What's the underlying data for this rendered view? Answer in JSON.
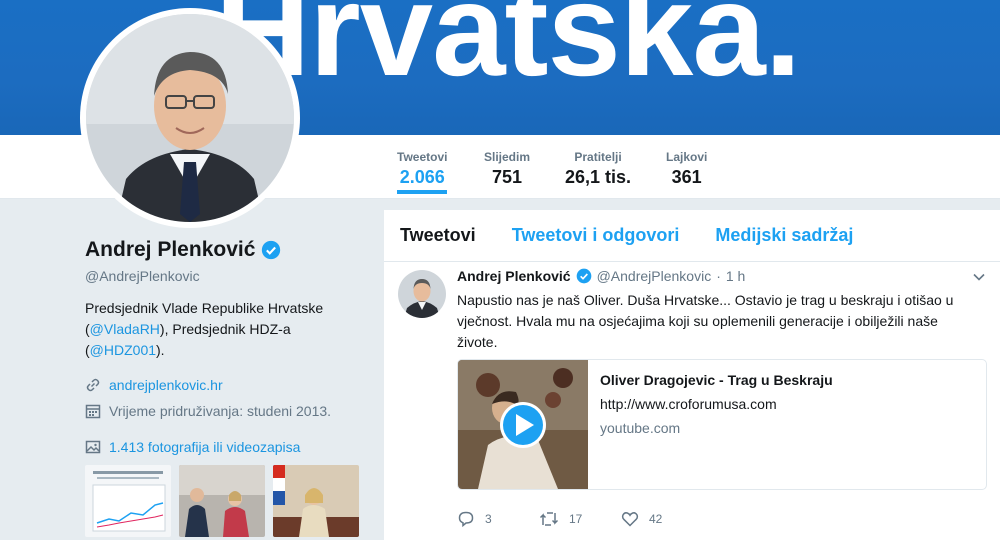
{
  "banner": {
    "text": "Hrvatska."
  },
  "stats": [
    {
      "label": "Tweetovi",
      "value": "2.066"
    },
    {
      "label": "Slijedim",
      "value": "751"
    },
    {
      "label": "Pratitelji",
      "value": "26,1 tis."
    },
    {
      "label": "Lajkovi",
      "value": "361"
    }
  ],
  "profile": {
    "name": "Andrej Plenković",
    "handle": "@AndrejPlenkovic",
    "bio": {
      "line1": "Predsjednik Vlade Republike Hrvatske",
      "open1": "(",
      "mention1": "@VladaRH",
      "mid": "), Predsjednik HDZ-a",
      "open2": "(",
      "mention2": "@HDZ001",
      "close2": ")."
    },
    "website": "andrejplenkovic.hr",
    "joined": "Vrijeme pridruživanja: studeni 2013.",
    "media": "1.413 fotografija ili videozapisa"
  },
  "tabs": [
    "Tweetovi",
    "Tweetovi i odgovori",
    "Medijski sadržaj"
  ],
  "tweet": {
    "name": "Andrej Plenković",
    "handle": "@AndrejPlenkovic",
    "sep": "·",
    "time": "1 h",
    "text": "Napustio nas je naš Oliver. Duša Hrvatske... Ostavio je trag u beskraju i otišao u vječnost. Hvala mu na osjećajima koji su oplemenili generacije i obilježili naše živote.",
    "card": {
      "title": "Oliver Dragojevic - Trag u Beskraju",
      "description": "http://www.croforumusa.com",
      "site": "youtube.com"
    },
    "replies": "3",
    "retweets": "17",
    "likes": "42"
  },
  "colors": {
    "accent": "#1da1f2",
    "banner": "#1a6fc4",
    "muted": "#657786"
  }
}
